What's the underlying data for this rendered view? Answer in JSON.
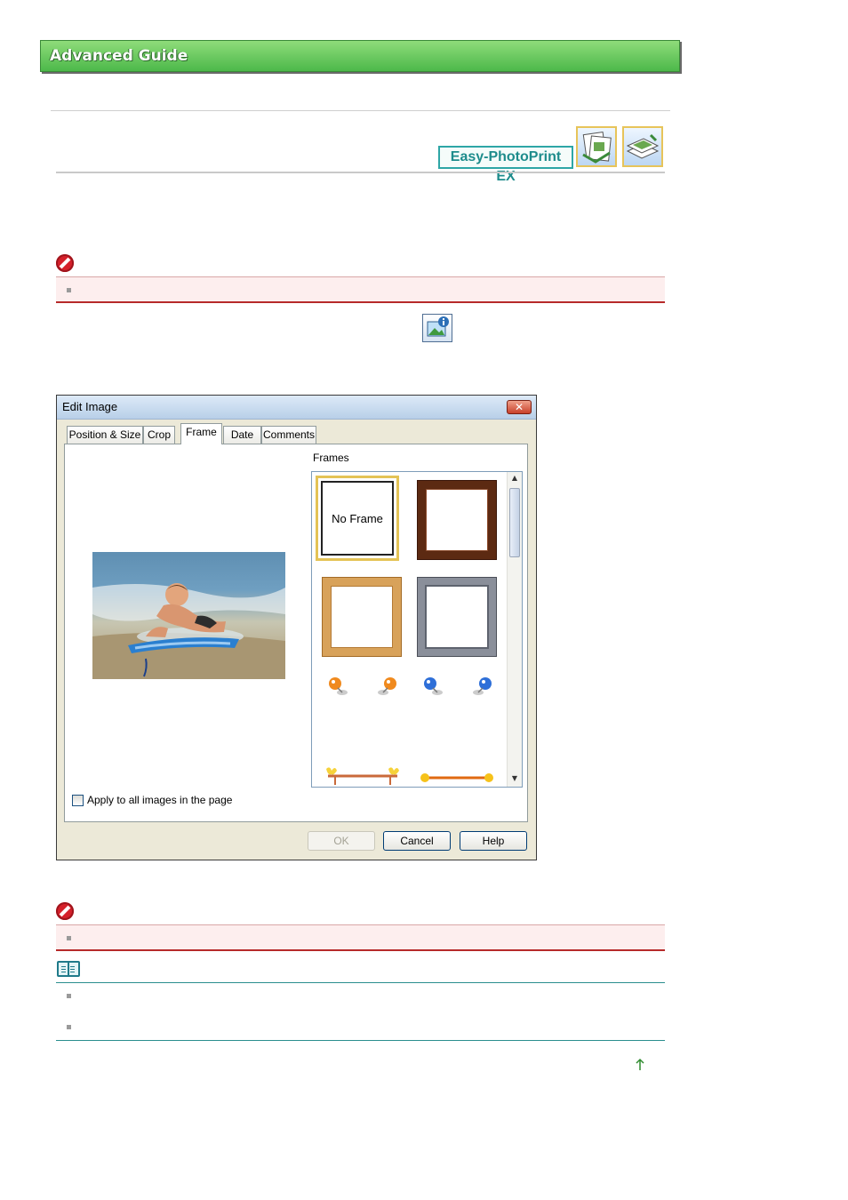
{
  "banner": {
    "title": "Advanced Guide"
  },
  "app_badge": {
    "label": "Easy-PhotoPrint EX"
  },
  "header_tiles": [
    "album-icon",
    "photo-print-icon"
  ],
  "dialog": {
    "title": "Edit Image",
    "close_label": "✕",
    "tabs": [
      "Position & Size",
      "Crop",
      "Frame",
      "Date",
      "Comments"
    ],
    "active_tab": "Frame",
    "frames_label": "Frames",
    "frames": [
      {
        "name": "No Frame",
        "label": "No Frame",
        "selected": true
      },
      {
        "name": "dark-wood-frame"
      },
      {
        "name": "light-wood-frame"
      },
      {
        "name": "silver-frame"
      },
      {
        "name": "orange-pins"
      },
      {
        "name": "blue-pins"
      },
      {
        "name": "butterfly-bar"
      },
      {
        "name": "orange-bar"
      }
    ],
    "checkbox_label": "Apply to all images in the page",
    "checkbox_checked": false,
    "buttons": {
      "ok": "OK",
      "cancel": "Cancel",
      "help": "Help"
    }
  },
  "icons": {
    "important": "stop-icon",
    "note": "note-book-icon",
    "image_info": "image-info-icon",
    "back_to_top": "up-arrow-icon"
  },
  "colors": {
    "banner": "#4cb84a",
    "important_border": "#b72a2a",
    "note_border": "#2a8e8e",
    "badge": "#2ea6a6"
  }
}
